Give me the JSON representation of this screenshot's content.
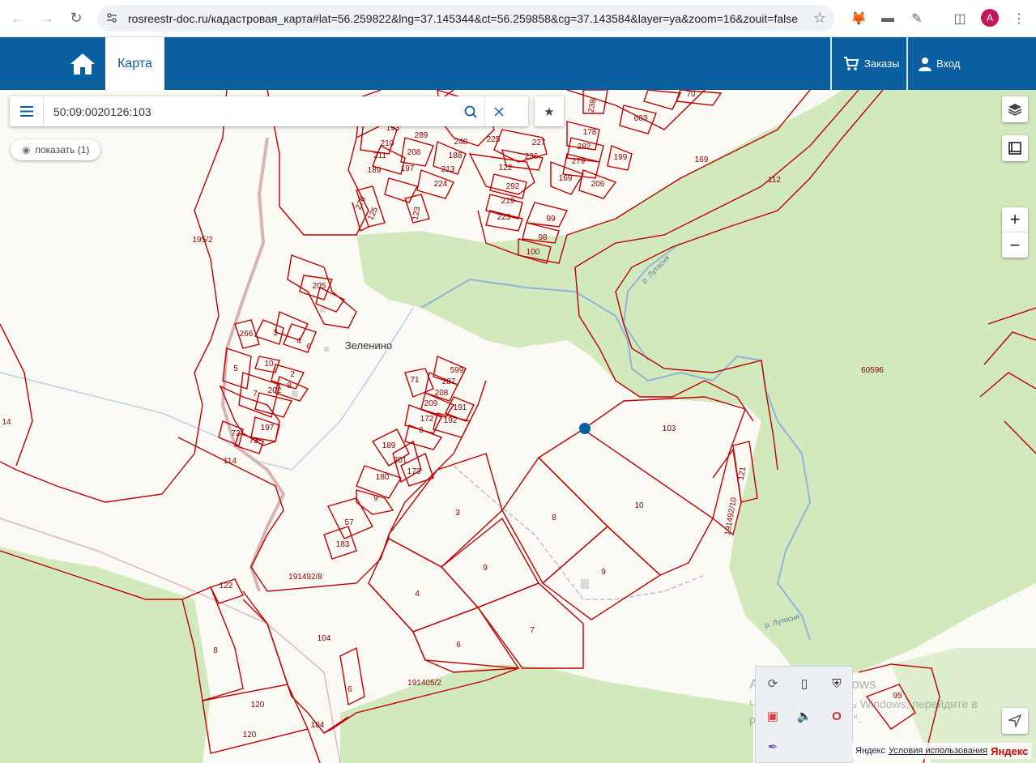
{
  "browser": {
    "url": "rosreestr-doc.ru/кадастровая_карта#lat=56.259822&lng=37.145344&ct=56.259858&cg=37.143584&layer=ya&zoom=16&zouit=false",
    "avatar_letter": "A"
  },
  "header": {
    "tab_label": "Карта",
    "orders_label": "Заказы",
    "login_label": "Вход",
    "brand_color": "#0a5fa0"
  },
  "search": {
    "value": "50:09:0020126:103",
    "show_label": "показать (1)"
  },
  "map": {
    "place_name": "Зеленино",
    "parcel_color": "#c00000",
    "forest_color": "#cfe8b8",
    "marker_color": "#0a5fa0",
    "river_labels": [
      "р. Лутосня",
      "р. Лутосня"
    ],
    "parcels": [
      {
        "label": "195/2"
      },
      {
        "label": "205"
      },
      {
        "label": "266"
      },
      {
        "label": "3"
      },
      {
        "label": "4"
      },
      {
        "label": "6"
      },
      {
        "label": "5"
      },
      {
        "label": "10"
      },
      {
        "label": "2"
      },
      {
        "label": "8"
      },
      {
        "label": "202"
      },
      {
        "label": "7"
      },
      {
        "label": "197"
      },
      {
        "label": "72"
      },
      {
        "label": "73"
      },
      {
        "label": "14"
      },
      {
        "label": "114"
      },
      {
        "label": "71"
      },
      {
        "label": "599"
      },
      {
        "label": "287"
      },
      {
        "label": "208"
      },
      {
        "label": "209"
      },
      {
        "label": "191"
      },
      {
        "label": "172"
      },
      {
        "label": "192"
      },
      {
        "label": "6"
      },
      {
        "label": "189"
      },
      {
        "label": "201"
      },
      {
        "label": "173"
      },
      {
        "label": "180"
      },
      {
        "label": "9"
      },
      {
        "label": "57"
      },
      {
        "label": "183"
      },
      {
        "label": "191492/8"
      },
      {
        "label": "122"
      },
      {
        "label": "8"
      },
      {
        "label": "104"
      },
      {
        "label": "120"
      },
      {
        "label": "120"
      },
      {
        "label": "104"
      },
      {
        "label": "6"
      },
      {
        "label": "191405/2"
      },
      {
        "label": "4"
      },
      {
        "label": "6"
      },
      {
        "label": "7"
      },
      {
        "label": "3"
      },
      {
        "label": "9"
      },
      {
        "label": "8"
      },
      {
        "label": "9"
      },
      {
        "label": "10"
      },
      {
        "label": "103"
      },
      {
        "label": "121"
      },
      {
        "label": "191492/10"
      },
      {
        "label": "60596"
      },
      {
        "label": "169"
      },
      {
        "label": "112"
      },
      {
        "label": "663"
      },
      {
        "label": "70"
      },
      {
        "label": "238"
      },
      {
        "label": "178"
      },
      {
        "label": "282"
      },
      {
        "label": "279"
      },
      {
        "label": "169"
      },
      {
        "label": "206"
      },
      {
        "label": "199"
      },
      {
        "label": "227"
      },
      {
        "label": "236"
      },
      {
        "label": "122"
      },
      {
        "label": "292"
      },
      {
        "label": "219"
      },
      {
        "label": "223"
      },
      {
        "label": "99"
      },
      {
        "label": "98"
      },
      {
        "label": "100"
      },
      {
        "label": "193"
      },
      {
        "label": "289"
      },
      {
        "label": "210"
      },
      {
        "label": "208"
      },
      {
        "label": "211"
      },
      {
        "label": "197"
      },
      {
        "label": "189"
      },
      {
        "label": "248"
      },
      {
        "label": "188"
      },
      {
        "label": "213"
      },
      {
        "label": "224"
      },
      {
        "label": "225"
      },
      {
        "label": "276"
      },
      {
        "label": "125"
      },
      {
        "label": "123"
      },
      {
        "label": "95"
      },
      {
        "label": "60596"
      }
    ]
  },
  "os_overlay": {
    "watermark_title": "Активация Windows",
    "watermark_text": "Чтобы активировать Windows, перейдите в раздел \"Параметры\"."
  },
  "footer": {
    "prefix": "Яндекс",
    "terms": "Условия использования",
    "brand": "Яндекс"
  }
}
